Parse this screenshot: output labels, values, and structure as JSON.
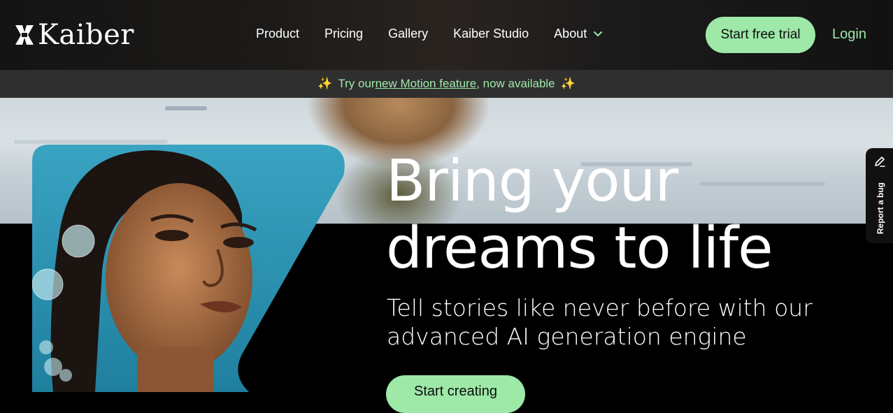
{
  "brand": {
    "name": "Kaiber"
  },
  "nav": {
    "items": [
      "Product",
      "Pricing",
      "Gallery",
      "Kaiber Studio",
      "About"
    ]
  },
  "header": {
    "trial_label": "Start free trial",
    "login_label": "Login"
  },
  "announcement": {
    "prefix": "Try our ",
    "link_text": "new Motion feature",
    "suffix": ", now available",
    "sparkle": "✨"
  },
  "hero": {
    "headline_line1": "Bring your",
    "headline_line2": "dreams to life",
    "sub_line1": "Tell stories like never before with our",
    "sub_line2": "advanced AI generation engine",
    "cta_label": "Start creating"
  },
  "feedback_tab": {
    "label": "Report a bug"
  },
  "colors": {
    "accent": "#9ee8a8",
    "announce_bg": "#2f2f2f",
    "sparkle": "#f3c54a"
  },
  "icons": [
    "kaiber-logo-icon",
    "chevron-down-icon",
    "pencil-icon",
    "sparkle-icon"
  ]
}
